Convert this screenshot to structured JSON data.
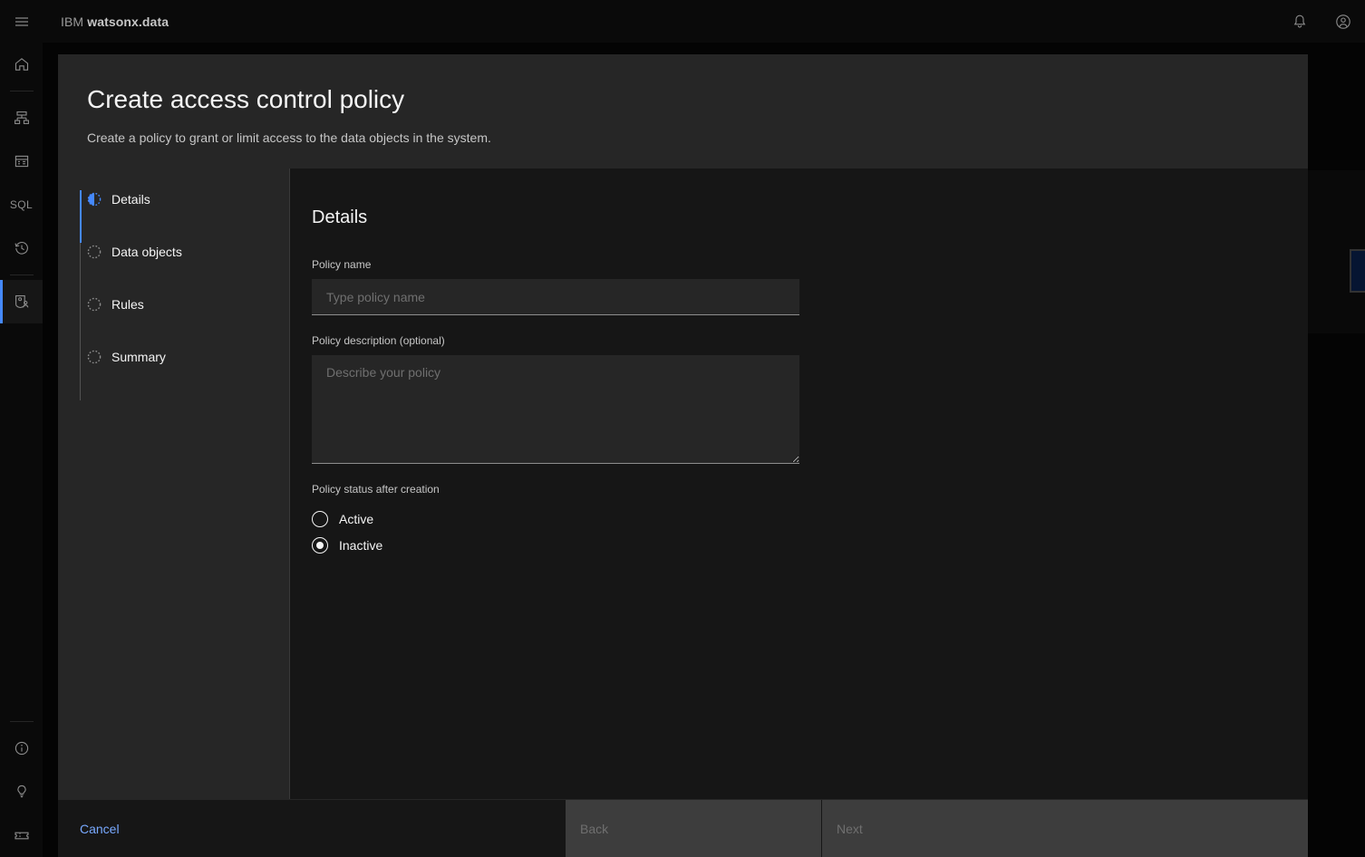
{
  "header": {
    "menu_icon": "hamburger-menu-icon",
    "brand_prefix": "IBM",
    "brand_name": "watsonx.data",
    "notifications_icon": "bell-icon",
    "account_icon": "user-avatar-icon"
  },
  "sidebar": {
    "items": [
      {
        "icon": "home-icon",
        "name": "home",
        "selected": false
      },
      {
        "icon": "infrastructure-icon",
        "name": "infrastructure-manager",
        "selected": false
      },
      {
        "icon": "data-manager-icon",
        "name": "data-manager",
        "selected": false
      },
      {
        "icon": "sql-icon",
        "name": "query-workspace",
        "label": "SQL",
        "selected": false
      },
      {
        "icon": "history-icon",
        "name": "query-history",
        "selected": false
      },
      {
        "icon": "access-control-icon",
        "name": "access-control",
        "selected": true
      }
    ],
    "bottom_items": [
      {
        "icon": "information-icon",
        "name": "about"
      },
      {
        "icon": "lightbulb-icon",
        "name": "tips"
      },
      {
        "icon": "ticket-icon",
        "name": "support"
      }
    ]
  },
  "background": {
    "add_button_label": "+"
  },
  "modal": {
    "title": "Create access control policy",
    "subtitle": "Create a policy to grant or limit access to the data objects in the system.",
    "steps": [
      {
        "label": "Details",
        "state": "current"
      },
      {
        "label": "Data objects",
        "state": "incomplete"
      },
      {
        "label": "Rules",
        "state": "incomplete"
      },
      {
        "label": "Summary",
        "state": "incomplete"
      }
    ],
    "content": {
      "heading": "Details",
      "policy_name": {
        "label": "Policy name",
        "placeholder": "Type policy name",
        "value": ""
      },
      "policy_description": {
        "label": "Policy description (optional)",
        "placeholder": "Describe your policy",
        "value": ""
      },
      "policy_status": {
        "legend": "Policy status after creation",
        "options": [
          {
            "label": "Active",
            "checked": false
          },
          {
            "label": "Inactive",
            "checked": true
          }
        ],
        "selected": "Inactive"
      }
    },
    "footer": {
      "cancel_label": "Cancel",
      "back_label": "Back",
      "next_label": "Next",
      "back_disabled": true,
      "next_disabled": true
    }
  },
  "colors": {
    "accent_blue": "#4589ff",
    "link_blue": "#78a9ff",
    "panel": "#262626",
    "content_bg": "#161616",
    "shell_bg": "#0a0a0a",
    "disabled_btn": "#3d3d3d"
  }
}
